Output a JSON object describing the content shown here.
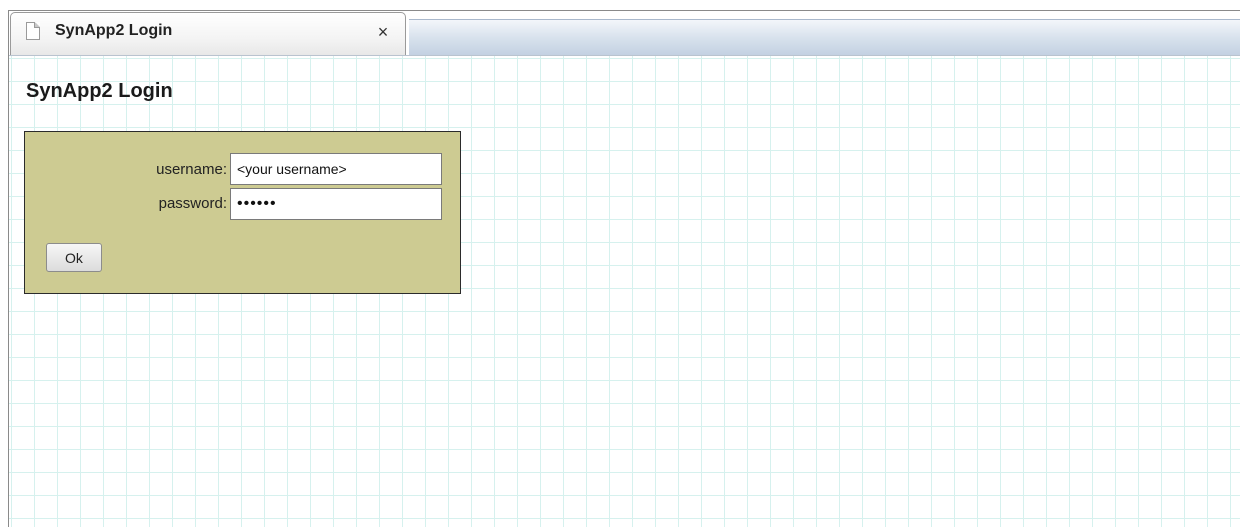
{
  "tab": {
    "title": "SynApp2 Login",
    "close_glyph": "×",
    "icon": "page-icon"
  },
  "page": {
    "title": "SynApp2 Login"
  },
  "login_form": {
    "username_label": "username:",
    "username_value": "<your username>",
    "password_label": "password:",
    "password_value": "••••••",
    "ok_label": "Ok"
  },
  "colors": {
    "panel_background": "#cdcb92",
    "grid_line": "#d6f1ee"
  }
}
